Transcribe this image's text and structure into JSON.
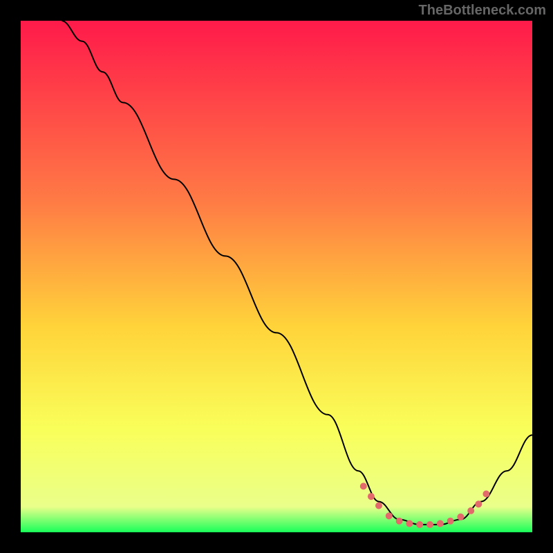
{
  "watermark": "TheBottleneck.com",
  "chart_data": {
    "type": "line",
    "title": "",
    "xlabel": "",
    "ylabel": "",
    "xlim": [
      0,
      100
    ],
    "ylim": [
      0,
      100
    ],
    "gradient_stops": [
      {
        "offset": 0,
        "color": "#ff1a4a"
      },
      {
        "offset": 35,
        "color": "#ff7a45"
      },
      {
        "offset": 60,
        "color": "#ffd43a"
      },
      {
        "offset": 80,
        "color": "#f9ff5a"
      },
      {
        "offset": 95,
        "color": "#eaff8a"
      },
      {
        "offset": 100,
        "color": "#19ff5a"
      }
    ],
    "series": [
      {
        "name": "bottleneck-curve",
        "color": "#000000",
        "points": [
          {
            "x": 8,
            "y": 100
          },
          {
            "x": 12,
            "y": 96
          },
          {
            "x": 16,
            "y": 90
          },
          {
            "x": 20,
            "y": 84
          },
          {
            "x": 30,
            "y": 69
          },
          {
            "x": 40,
            "y": 54
          },
          {
            "x": 50,
            "y": 39
          },
          {
            "x": 60,
            "y": 23
          },
          {
            "x": 66,
            "y": 12
          },
          {
            "x": 70,
            "y": 6
          },
          {
            "x": 74,
            "y": 2.5
          },
          {
            "x": 78,
            "y": 1.5
          },
          {
            "x": 82,
            "y": 1.5
          },
          {
            "x": 86,
            "y": 2.5
          },
          {
            "x": 90,
            "y": 6
          },
          {
            "x": 95,
            "y": 12
          },
          {
            "x": 100,
            "y": 19
          }
        ]
      }
    ],
    "markers": [
      {
        "x": 67,
        "y": 9
      },
      {
        "x": 68.5,
        "y": 7
      },
      {
        "x": 70,
        "y": 5.2
      },
      {
        "x": 72,
        "y": 3.2
      },
      {
        "x": 74,
        "y": 2.2
      },
      {
        "x": 76,
        "y": 1.7
      },
      {
        "x": 78,
        "y": 1.5
      },
      {
        "x": 80,
        "y": 1.5
      },
      {
        "x": 82,
        "y": 1.7
      },
      {
        "x": 84,
        "y": 2.2
      },
      {
        "x": 86,
        "y": 3
      },
      {
        "x": 88,
        "y": 4.2
      },
      {
        "x": 89.5,
        "y": 5.5
      },
      {
        "x": 91,
        "y": 7.5
      }
    ],
    "marker_color": "#e36a6a"
  }
}
